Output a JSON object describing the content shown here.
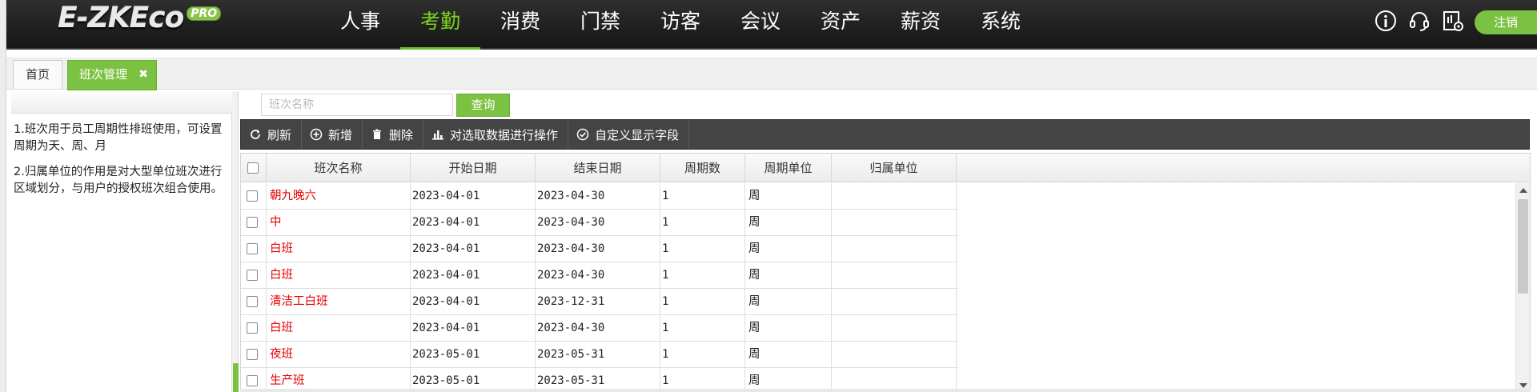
{
  "app": {
    "logo_text": "E-ZKEco",
    "logo_badge": "PRO"
  },
  "nav": {
    "items": [
      "人事",
      "考勤",
      "消费",
      "门禁",
      "访客",
      "会议",
      "资产",
      "薪资",
      "系统"
    ],
    "active_index": 1
  },
  "header_icons": [
    "info-icon",
    "headset-icon",
    "monitor-settings-icon"
  ],
  "logout_label": "注销",
  "tabs": {
    "home": "首页",
    "active": "班次管理",
    "close_glyph": "✖"
  },
  "help": {
    "lines": [
      "1.班次用于员工周期性排班使用，可设置周期为天、周、月",
      "2.归属单位的作用是对大型单位班次进行区域划分，与用户的授权班次组合使用。"
    ]
  },
  "search": {
    "placeholder": "班次名称",
    "value": "",
    "button": "查询"
  },
  "toolbar": {
    "refresh": "刷新",
    "add": "新增",
    "delete": "删除",
    "batch": "对选取数据进行操作",
    "custom_fields": "自定义显示字段"
  },
  "grid": {
    "columns": [
      "班次名称",
      "开始日期",
      "结束日期",
      "周期数",
      "周期单位",
      "归属单位"
    ],
    "rows": [
      {
        "name": "朝九晚六",
        "start": "2023-04-01",
        "end": "2023-04-30",
        "cycles": "1",
        "unit": "周",
        "dept": ""
      },
      {
        "name": "中",
        "start": "2023-04-01",
        "end": "2023-04-30",
        "cycles": "1",
        "unit": "周",
        "dept": ""
      },
      {
        "name": "白班",
        "start": "2023-04-01",
        "end": "2023-04-30",
        "cycles": "1",
        "unit": "周",
        "dept": ""
      },
      {
        "name": "白班",
        "start": "2023-04-01",
        "end": "2023-04-30",
        "cycles": "1",
        "unit": "周",
        "dept": ""
      },
      {
        "name": "清洁工白班",
        "start": "2023-04-01",
        "end": "2023-12-31",
        "cycles": "1",
        "unit": "周",
        "dept": ""
      },
      {
        "name": "白班",
        "start": "2023-04-01",
        "end": "2023-04-30",
        "cycles": "1",
        "unit": "周",
        "dept": ""
      },
      {
        "name": "夜班",
        "start": "2023-05-01",
        "end": "2023-05-31",
        "cycles": "1",
        "unit": "周",
        "dept": ""
      },
      {
        "name": "生产班",
        "start": "2023-05-01",
        "end": "2023-05-31",
        "cycles": "1",
        "unit": "周",
        "dept": ""
      }
    ]
  },
  "colors": {
    "accent": "#7cc242",
    "topbar": "#222222",
    "toolbar": "#444444",
    "name_text": "#e60000"
  }
}
